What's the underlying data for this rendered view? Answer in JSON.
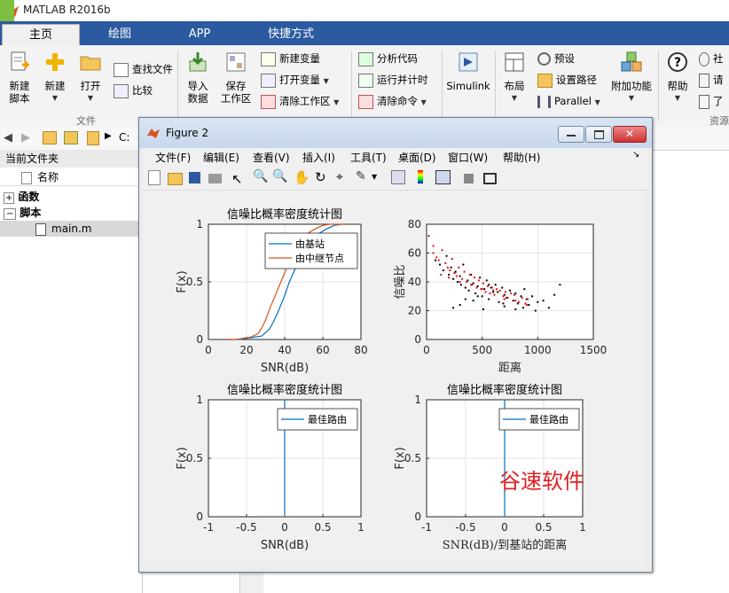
{
  "app": {
    "title": "MATLAB R2016b"
  },
  "tabs": [
    {
      "label": "主页"
    },
    {
      "label": "绘图"
    },
    {
      "label": "APP"
    },
    {
      "label": "快捷方式"
    }
  ],
  "ribbon": {
    "new_script": "新建\n脚本",
    "new": "新建",
    "open": "打开",
    "find_files": "查找文件",
    "compare": "比较",
    "import_data": "导入\n数据",
    "save_workspace": "保存\n工作区",
    "new_variable": "新建变量",
    "open_variable": "打开变量",
    "clear_workspace": "清除工作区",
    "analyze_code": "分析代码",
    "run_and_time": "运行并计时",
    "clear_commands": "清除命令",
    "simulink": "Simulink",
    "layout": "布局",
    "preferences": "预设",
    "set_path": "设置路径",
    "parallel": "Parallel",
    "addons": "附加功能",
    "help": "帮助",
    "community": "社",
    "request": "请",
    "learn": "了",
    "group_file": "文件",
    "group_resources": "资源"
  },
  "address": {
    "path": "C:"
  },
  "left_panel": {
    "title": "当前文件夹",
    "col_name": "名称",
    "items": [
      {
        "label": "函数"
      },
      {
        "label": "脚本"
      },
      {
        "label": "main.m"
      }
    ]
  },
  "figure": {
    "title": "Figure 2",
    "menus": [
      "文件(F)",
      "编辑(E)",
      "查看(V)",
      "插入(I)",
      "工具(T)",
      "桌面(D)",
      "窗口(W)",
      "帮助(H)"
    ],
    "watermark": "谷速软件"
  },
  "colors": {
    "series1": "#0072bd",
    "series2": "#d95319",
    "scatter_red": "#e01010",
    "scatter_black": "#000000",
    "ribbon_tab": "#2b5aa0"
  },
  "chart_data": [
    {
      "type": "line",
      "title": "信噪比概率密度统计图",
      "xlabel": "SNR(dB)",
      "ylabel": "F(x)",
      "xlim": [
        0,
        80
      ],
      "ylim": [
        0,
        1
      ],
      "xticks": [
        0,
        20,
        40,
        60,
        80
      ],
      "yticks": [
        0,
        0.5,
        1
      ],
      "xticklabels": [
        "0",
        "20",
        "40",
        "60",
        "80"
      ],
      "yticklabels": [
        "0",
        "0.5",
        "1"
      ],
      "grid": true,
      "legend": "top-right",
      "series": [
        {
          "name": "由基站",
          "x": [
            10,
            16,
            20,
            24,
            28,
            30,
            32,
            34,
            36,
            38,
            40,
            42,
            44,
            46,
            48,
            50,
            54,
            58,
            62,
            66,
            70,
            72
          ],
          "y": [
            0,
            0,
            0.01,
            0.02,
            0.03,
            0.06,
            0.09,
            0.15,
            0.22,
            0.3,
            0.38,
            0.48,
            0.56,
            0.63,
            0.7,
            0.78,
            0.86,
            0.92,
            0.96,
            0.99,
            1,
            1
          ]
        },
        {
          "name": "由中继节点",
          "x": [
            10,
            14,
            18,
            22,
            26,
            28,
            30,
            32,
            34,
            36,
            38,
            40,
            42,
            44,
            46,
            48,
            52,
            56,
            60,
            64,
            68,
            72
          ],
          "y": [
            0,
            0,
            0.01,
            0.02,
            0.05,
            0.1,
            0.17,
            0.26,
            0.34,
            0.42,
            0.5,
            0.58,
            0.66,
            0.73,
            0.8,
            0.86,
            0.92,
            0.96,
            0.99,
            1,
            1,
            1
          ]
        }
      ]
    },
    {
      "type": "scatter",
      "title": "",
      "xlabel": "距离",
      "ylabel": "信噪比",
      "xlim": [
        0,
        1500
      ],
      "ylim": [
        0,
        80
      ],
      "xticks": [
        0,
        500,
        1000,
        1500
      ],
      "yticks": [
        0,
        20,
        40,
        60,
        80
      ],
      "xticklabels": [
        "0",
        "500",
        "1000",
        "1500"
      ],
      "yticklabels": [
        "0",
        "20",
        "40",
        "60",
        "80"
      ],
      "grid": true,
      "series": [
        {
          "name": "",
          "color": "#000000",
          "x": [
            80,
            120,
            150,
            180,
            200,
            220,
            240,
            260,
            280,
            300,
            310,
            330,
            350,
            370,
            380,
            400,
            420,
            440,
            460,
            480,
            500,
            520,
            540,
            560,
            600,
            620,
            650,
            680,
            700,
            720,
            750,
            780,
            800,
            820,
            850,
            870,
            900,
            920,
            950,
            980,
            1000,
            1050,
            1100,
            1150,
            1200,
            240,
            300,
            420,
            510,
            560,
            640,
            700,
            880,
            260,
            350,
            460,
            580,
            690,
            800
          ],
          "y": [
            55,
            52,
            48,
            58,
            45,
            50,
            42,
            47,
            40,
            44,
            38,
            52,
            36,
            41,
            34,
            45,
            39,
            32,
            37,
            43,
            30,
            35,
            41,
            28,
            33,
            38,
            26,
            36,
            31,
            29,
            34,
            27,
            32,
            25,
            30,
            22,
            28,
            24,
            30,
            20,
            26,
            27,
            22,
            31,
            38,
            22,
            24,
            27,
            21,
            38,
            33,
            23,
            35,
            47,
            28,
            30,
            36,
            25,
            21
          ]
        },
        {
          "name": "",
          "color": "#e01010",
          "x": [
            20,
            60,
            90,
            110,
            140,
            170,
            190,
            210,
            230,
            250,
            270,
            290,
            320,
            340,
            360,
            390,
            410,
            430,
            450,
            470,
            490,
            510,
            530,
            550,
            570,
            590,
            610,
            630,
            660,
            690,
            710,
            730,
            760,
            790,
            830,
            860,
            890,
            910,
            60,
            130,
            200,
            300,
            400,
            500,
            600,
            700,
            800,
            900
          ],
          "y": [
            72,
            60,
            57,
            55,
            62,
            53,
            50,
            48,
            56,
            46,
            44,
            50,
            42,
            47,
            40,
            45,
            38,
            43,
            36,
            41,
            35,
            39,
            33,
            37,
            32,
            36,
            31,
            35,
            34,
            30,
            33,
            29,
            32,
            31,
            26,
            29,
            25,
            28,
            65,
            45,
            43,
            40,
            38,
            35,
            34,
            28,
            27,
            24
          ]
        }
      ]
    },
    {
      "type": "line",
      "title": "信噪比概率密度统计图",
      "xlabel": "SNR(dB)",
      "ylabel": "F(x)",
      "xlim": [
        -1,
        1
      ],
      "ylim": [
        0,
        1
      ],
      "xticks": [
        -1,
        -0.5,
        0,
        0.5,
        1
      ],
      "yticks": [
        0,
        0.5,
        1
      ],
      "xticklabels": [
        "-1",
        "-0.5",
        "0",
        "0.5",
        "1"
      ],
      "yticklabels": [
        "0",
        "0.5",
        "1"
      ],
      "grid": true,
      "legend": "top-right",
      "series": [
        {
          "name": "最佳路由",
          "x": [
            0,
            0
          ],
          "y": [
            0,
            1
          ]
        }
      ]
    },
    {
      "type": "line",
      "title": "信噪比概率密度统计图",
      "xlabel": "SNR(dB)/到基站的距离",
      "ylabel": "F(x)",
      "xlim": [
        -1,
        1
      ],
      "ylim": [
        0,
        1
      ],
      "xticks": [
        -1,
        -0.5,
        0,
        0.5,
        1
      ],
      "yticks": [
        0,
        0.5,
        1
      ],
      "xticklabels": [
        "-1",
        "-0.5",
        "0",
        "0.5",
        "1"
      ],
      "yticklabels": [
        "0",
        "0.5",
        "1"
      ],
      "grid": true,
      "legend": "top-right",
      "series": [
        {
          "name": "最佳路由",
          "x": [
            0,
            0
          ],
          "y": [
            0,
            1
          ]
        }
      ]
    }
  ]
}
